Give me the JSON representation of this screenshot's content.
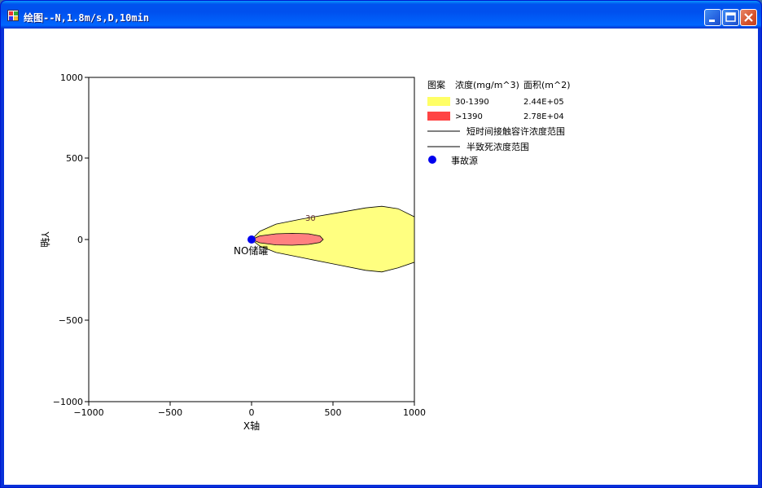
{
  "window": {
    "title": "绘图--N,1.8m/s,D,10min",
    "colors": {
      "titlebar": "#0058ee",
      "frame": "#0831d9",
      "client": "#ffffff"
    }
  },
  "chart_data": {
    "type": "area",
    "xlabel": "X轴",
    "ylabel": "Y轴",
    "xlim": [
      -1000,
      1000
    ],
    "ylim": [
      -1000,
      1000
    ],
    "x_ticks": [
      "−1000",
      "−500",
      "0",
      "500",
      "1000"
    ],
    "y_ticks": [
      "1000",
      "500",
      "0",
      "−500",
      "−1000"
    ],
    "grid": false,
    "legend_position": "right",
    "legend": {
      "header": {
        "pattern": "图案",
        "concentration": "浓度(mg/m^3)",
        "area": "面积(m^2)"
      },
      "rows": [
        {
          "range": "30-1390",
          "area": "2.44E+05",
          "color": "#ffff66"
        },
        {
          "range": ">1390",
          "area": "2.78E+04",
          "color": "#ff4444"
        }
      ],
      "line_items": [
        "短时间接触容许浓度范围",
        "半致死浓度范围"
      ],
      "source_label": "事故源",
      "source_color": "#0000ee"
    },
    "series": [
      {
        "range": "30-1390",
        "color": "#ffff80",
        "points": [
          [
            0,
            0
          ],
          [
            50,
            50
          ],
          [
            150,
            95
          ],
          [
            300,
            125
          ],
          [
            500,
            160
          ],
          [
            700,
            195
          ],
          [
            800,
            205
          ],
          [
            900,
            190
          ],
          [
            1000,
            140
          ],
          [
            1000,
            -140
          ],
          [
            900,
            -175
          ],
          [
            800,
            -200
          ],
          [
            700,
            -190
          ],
          [
            500,
            -150
          ],
          [
            300,
            -110
          ],
          [
            150,
            -80
          ],
          [
            50,
            -40
          ]
        ]
      },
      {
        "range": ">1390",
        "color": "#ff8080",
        "points": [
          [
            0,
            0
          ],
          [
            50,
            22
          ],
          [
            150,
            35
          ],
          [
            250,
            38
          ],
          [
            350,
            35
          ],
          [
            420,
            22
          ],
          [
            440,
            0
          ],
          [
            420,
            -18
          ],
          [
            350,
            -30
          ],
          [
            250,
            -35
          ],
          [
            150,
            -33
          ],
          [
            50,
            -20
          ]
        ]
      }
    ],
    "contour_label": {
      "text": "30",
      "x": 330,
      "y": 115
    },
    "source": {
      "x": 0,
      "y": 0,
      "label": "NO储罐"
    }
  }
}
